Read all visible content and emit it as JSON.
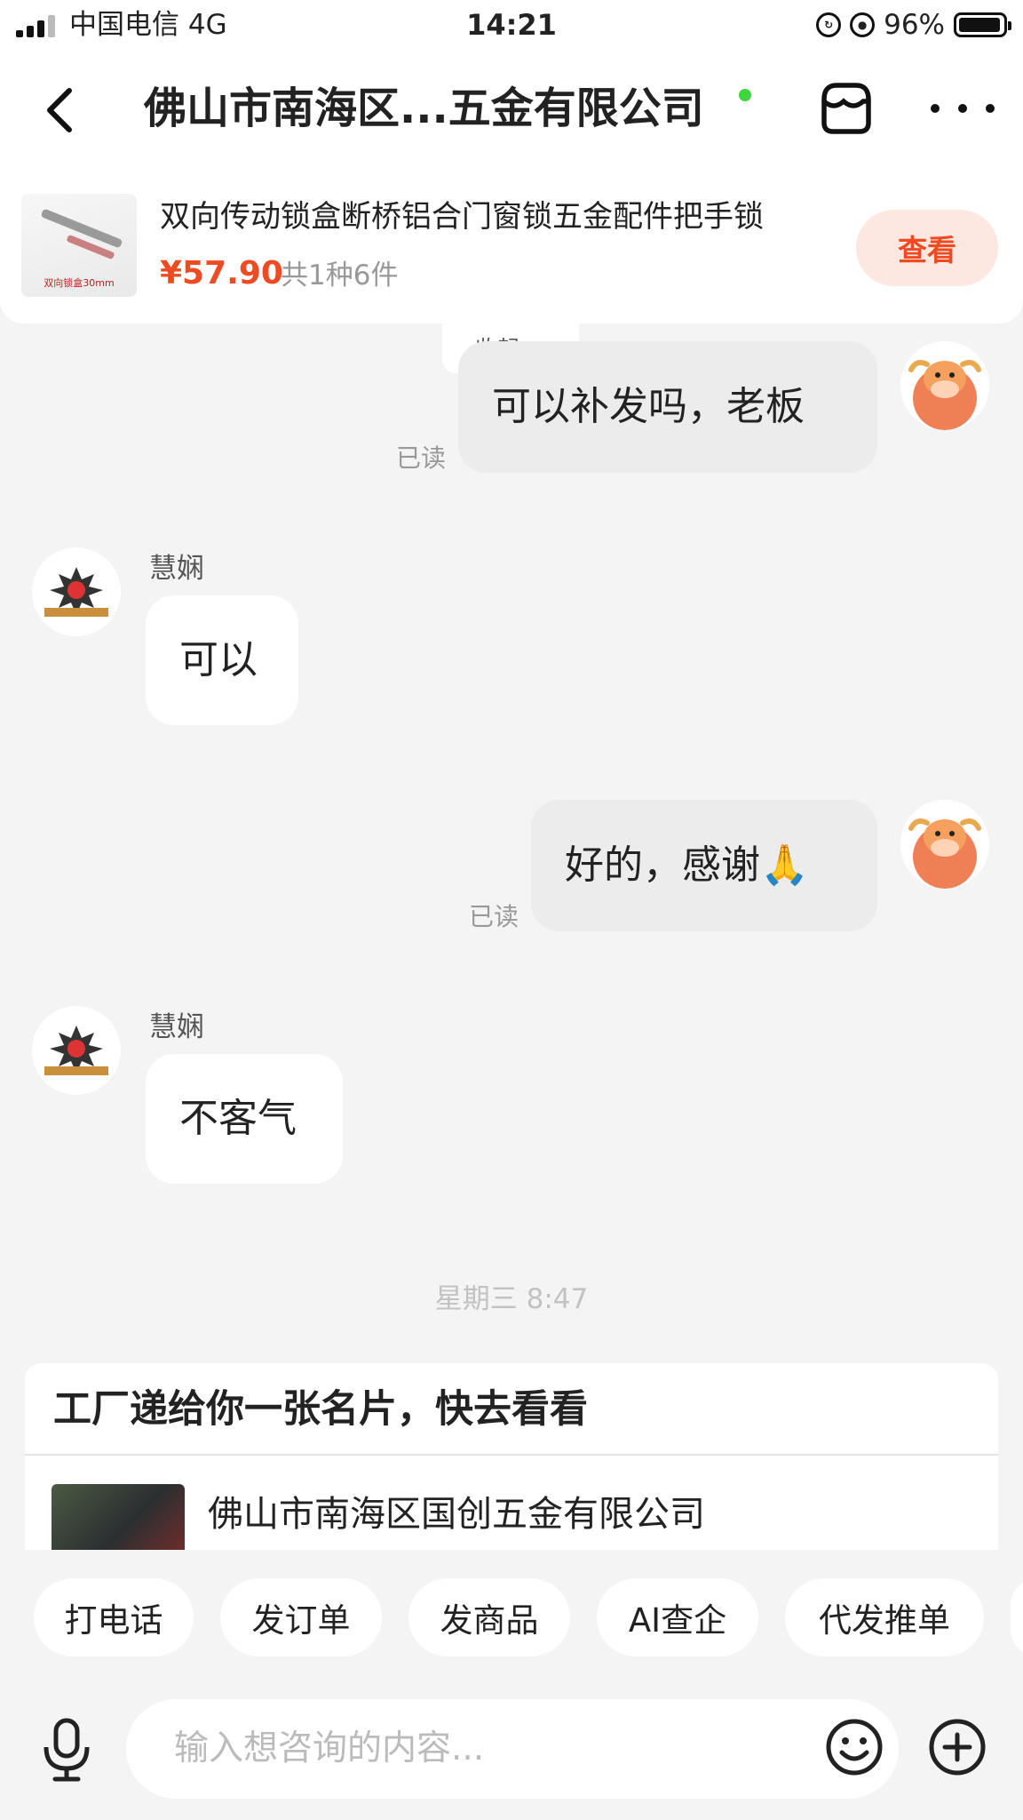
{
  "status_bar": {
    "carrier": "中国电信   4G",
    "time": "14:21",
    "battery": "96%",
    "battery_level": 0.96
  },
  "nav": {
    "title": "佛山市南海区...五金有限公司",
    "online": true
  },
  "product": {
    "title": "双向传动锁盒断桥铝合门窗锁五金配件把手锁",
    "thumb_caption": "双向锁盒30mm",
    "price": "¥57.90",
    "count": "共1种6件",
    "view_label": "查看"
  },
  "collapse_label": "收起",
  "messages": [
    {
      "from": "me",
      "text": "可以补发吗，老板",
      "read": "已读"
    },
    {
      "from": "them",
      "sender": "慧娴",
      "text": "可以"
    },
    {
      "from": "me",
      "text": "好的，感谢🙏",
      "read": "已读"
    },
    {
      "from": "them",
      "sender": "慧娴",
      "text": "不客气"
    }
  ],
  "time_separator": "星期三 8:47",
  "card": {
    "title": "工厂递给你一张名片，快去看看",
    "company": "佛山市南海区国创五金有限公司"
  },
  "quick_actions": [
    "打电话",
    "发订单",
    "发商品",
    "AI查企",
    "代发推单"
  ],
  "input": {
    "placeholder": "输入想咨询的内容..."
  },
  "colors": {
    "accent": "#ee4b22",
    "view_button_bg": "#fde8e1",
    "online_dot": "#3dd63d",
    "my_bubble": "#ececec",
    "their_bubble": "#ffffff",
    "background": "#f4f4f4"
  },
  "icons": {
    "back": "chevron-left-icon",
    "shop": "store-icon",
    "more": "more-dots-icon",
    "mic": "microphone-icon",
    "emoji": "smiley-icon",
    "plus": "plus-circle-icon"
  }
}
